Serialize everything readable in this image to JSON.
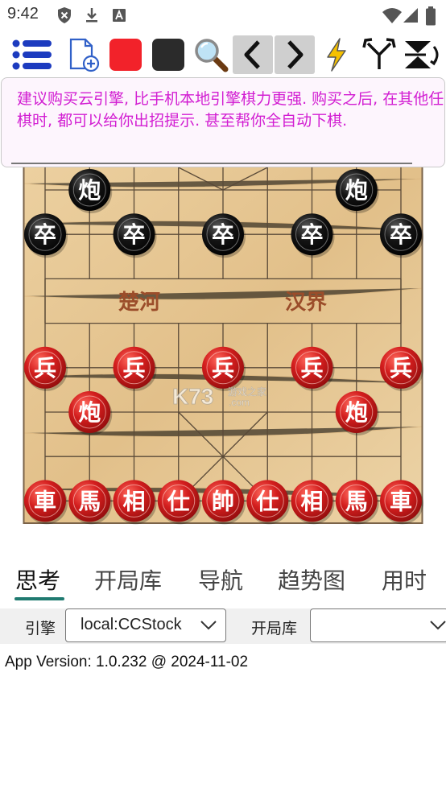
{
  "status_bar": {
    "time": "9:42"
  },
  "banner": {
    "text": "建议购买云引擎, 比手机本地引擎棋力更强. 购买之后, 在其他任何平台下棋时, 都可以给你出招提示. 甚至帮你全自动下棋."
  },
  "board": {
    "river_left": "楚河",
    "river_right": "汉界",
    "watermark_main": "K73",
    "watermark_sub": "游戏之家",
    "watermark_dom": ".com",
    "black_pieces": [
      {
        "char": "炮",
        "col": 1,
        "row": 0
      },
      {
        "char": "炮",
        "col": 7,
        "row": 0
      },
      {
        "char": "卒",
        "col": 0,
        "row": 1
      },
      {
        "char": "卒",
        "col": 2,
        "row": 1
      },
      {
        "char": "卒",
        "col": 4,
        "row": 1
      },
      {
        "char": "卒",
        "col": 6,
        "row": 1
      },
      {
        "char": "卒",
        "col": 8,
        "row": 1
      }
    ],
    "red_pieces": [
      {
        "char": "兵",
        "col": 0,
        "row": 4
      },
      {
        "char": "兵",
        "col": 2,
        "row": 4
      },
      {
        "char": "兵",
        "col": 4,
        "row": 4
      },
      {
        "char": "兵",
        "col": 6,
        "row": 4
      },
      {
        "char": "兵",
        "col": 8,
        "row": 4
      },
      {
        "char": "炮",
        "col": 1,
        "row": 5
      },
      {
        "char": "炮",
        "col": 7,
        "row": 5
      },
      {
        "char": "車",
        "col": 0,
        "row": 7
      },
      {
        "char": "馬",
        "col": 1,
        "row": 7
      },
      {
        "char": "相",
        "col": 2,
        "row": 7
      },
      {
        "char": "仕",
        "col": 3,
        "row": 7
      },
      {
        "char": "帥",
        "col": 4,
        "row": 7
      },
      {
        "char": "仕",
        "col": 5,
        "row": 7
      },
      {
        "char": "相",
        "col": 6,
        "row": 7
      },
      {
        "char": "馬",
        "col": 7,
        "row": 7
      },
      {
        "char": "車",
        "col": 8,
        "row": 7
      }
    ]
  },
  "tabs": [
    {
      "label": "思考",
      "active": true
    },
    {
      "label": "开局库",
      "active": false
    },
    {
      "label": "导航",
      "active": false
    },
    {
      "label": "趋势图",
      "active": false
    },
    {
      "label": "用时",
      "active": false
    }
  ],
  "engine": {
    "label": "引擎",
    "value": "local:CCStock",
    "book_label": "开局库",
    "book_value": ""
  },
  "version": "App Version: 1.0.232 @ 2024-11-02",
  "colors": {
    "banner_text": "#d21ed2",
    "tab_indicator": "#1f7a70",
    "red_piece": "#c8161d",
    "black_piece": "#0a0a0a"
  }
}
